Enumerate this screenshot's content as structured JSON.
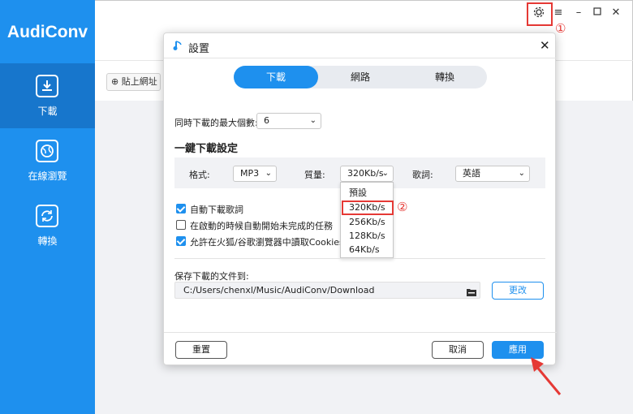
{
  "app": {
    "title": "AudiConv",
    "paste_url_label": "貼上網址",
    "annotation_1": "①",
    "annotation_2": "②"
  },
  "sidebar": {
    "items": [
      {
        "label": "下載",
        "icon": "download-icon",
        "active": true
      },
      {
        "label": "在線瀏覽",
        "icon": "globe-icon",
        "active": false
      },
      {
        "label": "轉換",
        "icon": "convert-icon",
        "active": false
      }
    ]
  },
  "window_controls": [
    "gear-icon",
    "menu-icon",
    "minimize-icon",
    "maximize-icon",
    "close-icon"
  ],
  "dialog": {
    "title": "設置",
    "tabs": [
      {
        "label": "下載",
        "active": true
      },
      {
        "label": "網路",
        "active": false
      },
      {
        "label": "轉換",
        "active": false
      }
    ],
    "max_downloads_label": "同時下載的最大個數:",
    "max_downloads_value": "6",
    "one_click_title": "一鍵下載設定",
    "format_label": "格式:",
    "format_value": "MP3",
    "quality_label": "質量:",
    "quality_value": "320Kb/s",
    "quality_options": [
      "預設",
      "320Kb/s",
      "256Kb/s",
      "128Kb/s",
      "64Kb/s"
    ],
    "lyrics_label": "歌詞:",
    "lyrics_value": "英語",
    "checkboxes": [
      {
        "label": "自動下載歌詞",
        "checked": true
      },
      {
        "label": "在啟動的時候自動開始未完成的任務",
        "checked": false
      },
      {
        "label": "允許在火狐/谷歌瀏覽器中讀取Cookies",
        "checked": true
      }
    ],
    "save_label": "保存下載的文件到:",
    "save_path": "C:/Users/chenxl/Music/AudiConv/Download",
    "change_button": "更改",
    "reset_button": "重置",
    "cancel_button": "取消",
    "apply_button": "應用"
  },
  "colors": {
    "accent": "#1e90ee",
    "sidebar_active": "#1776cc",
    "annotation": "#e53935"
  }
}
